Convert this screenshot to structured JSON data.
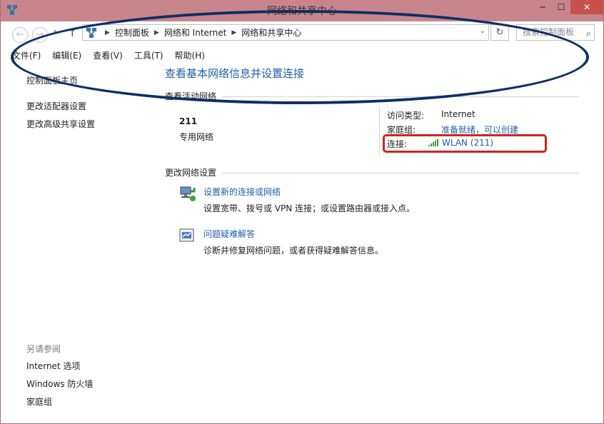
{
  "window": {
    "title": "网络和共享中心",
    "minimize": "─",
    "maximize": "☐",
    "close": "✕"
  },
  "navigation": {
    "back": "←",
    "forward": "→",
    "recent": "▾",
    "up": "↑",
    "breadcrumbs": [
      "控制面板",
      "网络和 Internet",
      "网络和共享中心"
    ],
    "address_dropdown": "⌄",
    "refresh": "↻",
    "search_placeholder": "搜索控制面板"
  },
  "menu": [
    "文件(F)",
    "编辑(E)",
    "查看(V)",
    "工具(T)",
    "帮助(H)"
  ],
  "sidebar": {
    "items": [
      "控制面板主页",
      "更改适配器设置",
      "更改高级共享设置"
    ],
    "see_also_heading": "另请参阅",
    "see_also": [
      "Internet 选项",
      "Windows 防火墙",
      "家庭组"
    ]
  },
  "main": {
    "title": "查看基本网络信息并设置连接",
    "active_networks_heading": "查看活动网络",
    "network": {
      "name": "211",
      "type": "专用网络",
      "properties": [
        {
          "label": "访问类型:",
          "value": "Internet"
        },
        {
          "label": "家庭组:",
          "value": "准备就绪，可以创建"
        },
        {
          "label": "连接:",
          "value": "WLAN (211)"
        }
      ]
    },
    "change_settings_heading": "更改网络设置",
    "tasks": [
      {
        "link": "设置新的连接或网络",
        "description": "设置宽带、拨号或 VPN 连接；或设置路由器或接入点。"
      },
      {
        "link": "问题疑难解答",
        "description": "诊断并修复网络问题，或者获得疑难解答信息。"
      }
    ]
  },
  "colors": {
    "titlebar": "#c8868c",
    "link": "#1e5ea8",
    "annotation_ellipse": "#0e2f66",
    "annotation_box": "#d0231e",
    "signal": "#3aa535"
  }
}
